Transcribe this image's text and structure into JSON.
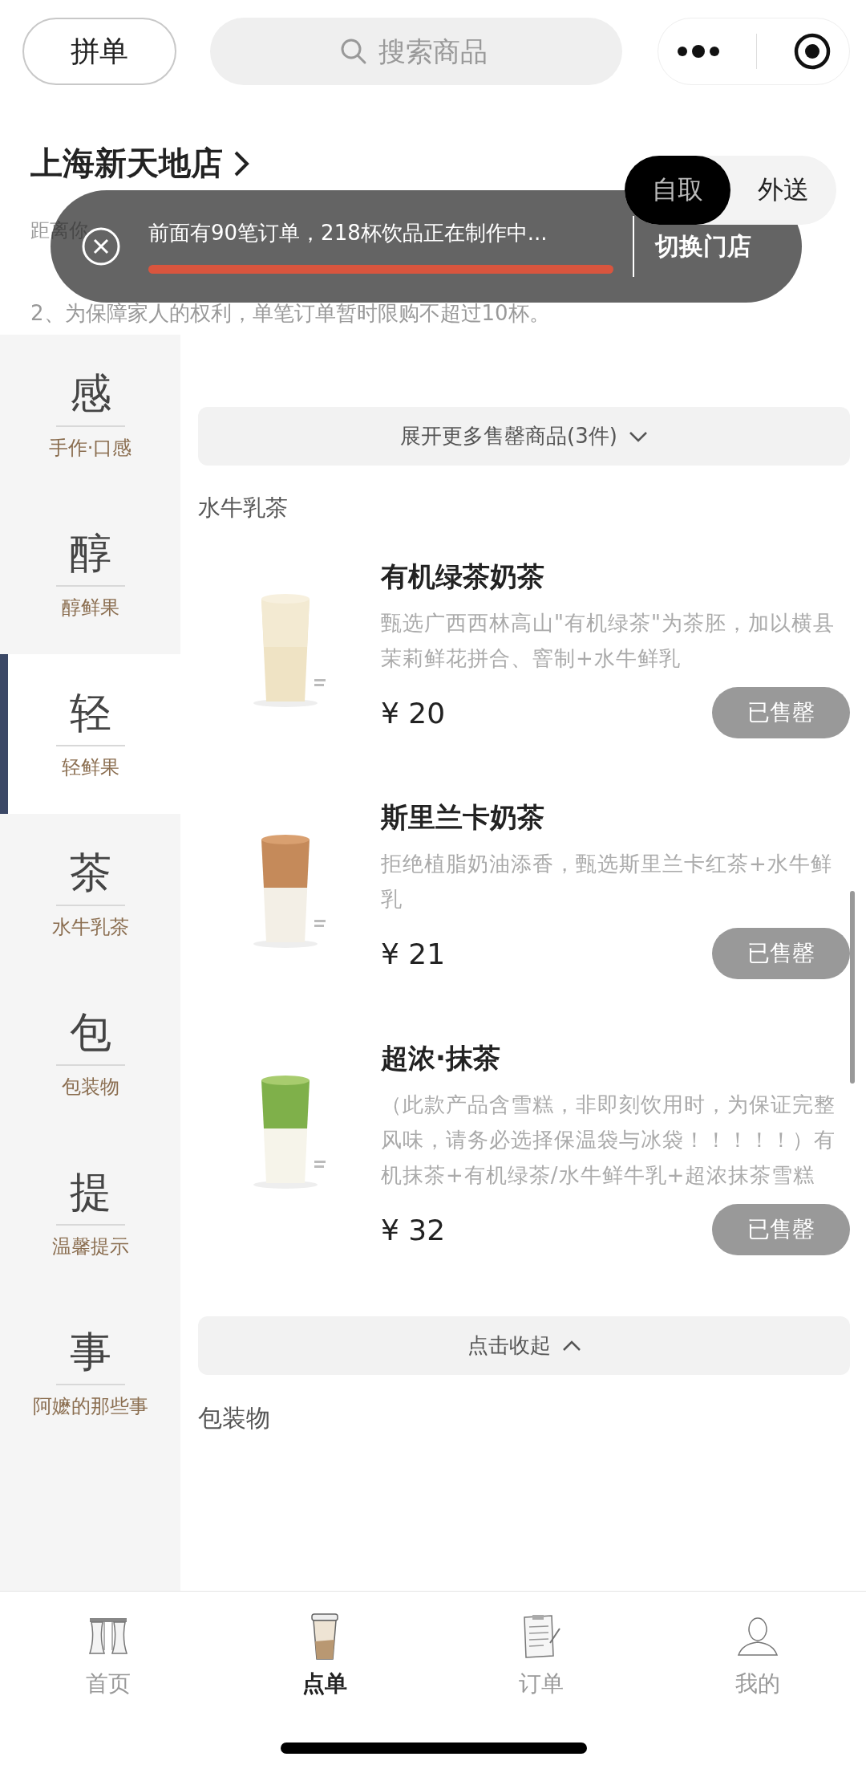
{
  "top_bar": {
    "group_order_button": "拼单",
    "search": {
      "placeholder": "搜索商品"
    }
  },
  "store": {
    "name": "上海新天地店",
    "distance": "距离你",
    "modes": [
      {
        "label": "自取",
        "selected": true
      },
      {
        "label": "外送",
        "selected": false
      }
    ],
    "notice": "2、为保障家人的权利，单笔订单暂时限购不超过10杯。"
  },
  "toast": {
    "message": "前面有90笔订单，218杯饮品正在制作中...",
    "action": "切换门店"
  },
  "sidebar": {
    "items": [
      {
        "char": "感",
        "label": "手作·口感",
        "selected": false
      },
      {
        "char": "醇",
        "label": "醇鲜果",
        "selected": false
      },
      {
        "char": "轻",
        "label": "轻鲜果",
        "selected": true
      },
      {
        "char": "茶",
        "label": "水牛乳茶",
        "selected": false
      },
      {
        "char": "包",
        "label": "包装物",
        "selected": false
      },
      {
        "char": "提",
        "label": "温馨提示",
        "selected": false
      },
      {
        "char": "事",
        "label": "阿嬷的那些事",
        "selected": false
      }
    ]
  },
  "menu": {
    "expand_button": "展开更多售罄商品(3件)",
    "section": {
      "title": "水牛乳茶",
      "products": [
        {
          "name": "有机绿茶奶茶",
          "description": "甄选广西西林高山\"有机绿茶\"为茶胚，加以横县茉莉鲜花拼合、窨制+水牛鲜乳",
          "price": "¥ 20",
          "button": "已售罄",
          "sold_out": true
        },
        {
          "name": "斯里兰卡奶茶",
          "description": "拒绝植脂奶油添香，甄选斯里兰卡红茶+水牛鲜乳",
          "price": "¥ 21",
          "button": "已售罄",
          "sold_out": true
        },
        {
          "name": "超浓·抹茶",
          "description": "（此款产品含雪糕，非即刻饮用时，为保证完整风味，请务必选择保温袋与冰袋！！！！！）有机抹茶+有机绿茶/水牛鲜牛乳+超浓抹茶雪糕",
          "price": "¥ 32",
          "button": "已售罄",
          "sold_out": true
        }
      ]
    },
    "collapse_button": "点击收起",
    "next_section": "包装物"
  },
  "tab_bar": {
    "items": [
      {
        "kind": "curtain",
        "label": "首页",
        "selected": false
      },
      {
        "kind": "cup",
        "label": "点单",
        "selected": true
      },
      {
        "kind": "clipboard",
        "label": "订单",
        "selected": false
      },
      {
        "kind": "person",
        "label": "我的",
        "selected": false
      }
    ]
  }
}
